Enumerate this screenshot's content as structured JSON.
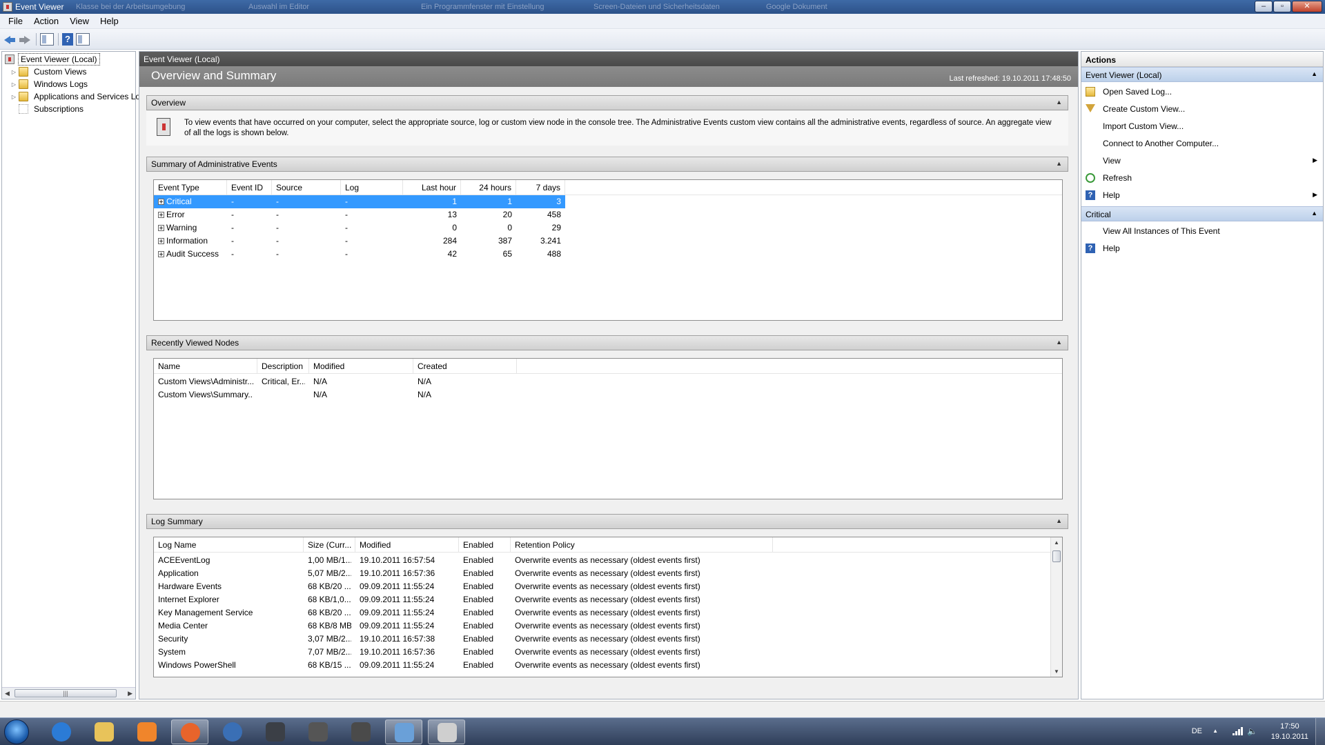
{
  "window": {
    "title": "Event Viewer",
    "ghost_tabs": [
      "Klasse bei der Arbeitsumgebung",
      "Auswahl im Editor",
      "Ein Programmfenster mit Einstellung",
      "Screen-Dateien und Sicherheitsdaten",
      "Google Dokument"
    ]
  },
  "menu": [
    "File",
    "Action",
    "View",
    "Help"
  ],
  "tree": [
    {
      "label": "Event Viewer (Local)",
      "icon": "event-viewer-icon"
    },
    {
      "label": "Custom Views",
      "icon": "folder-icon"
    },
    {
      "label": "Windows Logs",
      "icon": "folder-icon"
    },
    {
      "label": "Applications and Services Lo",
      "icon": "folder-icon"
    },
    {
      "label": "Subscriptions",
      "icon": "subscriptions-icon"
    }
  ],
  "center": {
    "header": "Event Viewer (Local)",
    "banner_title": "Overview and Summary",
    "last_refreshed": "Last refreshed: 19.10.2011 17:48:50",
    "overview": {
      "title": "Overview",
      "text": "To view events that have occurred on your computer, select the appropriate source, log or custom view node in the console tree. The Administrative Events custom view contains all the administrative events, regardless of source. An aggregate view of all the logs is shown below."
    },
    "summary": {
      "title": "Summary of Administrative Events",
      "columns": [
        "Event Type",
        "Event ID",
        "Source",
        "Log",
        "Last hour",
        "24 hours",
        "7 days"
      ],
      "rows": [
        [
          "Critical",
          "-",
          "-",
          "-",
          "1",
          "1",
          "3"
        ],
        [
          "Error",
          "-",
          "-",
          "-",
          "13",
          "20",
          "458"
        ],
        [
          "Warning",
          "-",
          "-",
          "-",
          "0",
          "0",
          "29"
        ],
        [
          "Information",
          "-",
          "-",
          "-",
          "284",
          "387",
          "3.241"
        ],
        [
          "Audit Success",
          "-",
          "-",
          "-",
          "42",
          "65",
          "488"
        ]
      ]
    },
    "recent": {
      "title": "Recently Viewed Nodes",
      "columns": [
        "Name",
        "Description",
        "Modified",
        "Created"
      ],
      "rows": [
        [
          "Custom Views\\Administr...",
          "Critical, Er...",
          "N/A",
          "N/A"
        ],
        [
          "Custom Views\\Summary...",
          "",
          "N/A",
          "N/A"
        ]
      ]
    },
    "log_summary": {
      "title": "Log Summary",
      "columns": [
        "Log Name",
        "Size (Curr...",
        "Modified",
        "Enabled",
        "Retention Policy"
      ],
      "rows": [
        [
          "ACEEventLog",
          "1,00 MB/1...",
          "19.10.2011 16:57:54",
          "Enabled",
          "Overwrite events as necessary (oldest events first)"
        ],
        [
          "Application",
          "5,07 MB/2...",
          "19.10.2011 16:57:36",
          "Enabled",
          "Overwrite events as necessary (oldest events first)"
        ],
        [
          "Hardware Events",
          "68 KB/20 ...",
          "09.09.2011 11:55:24",
          "Enabled",
          "Overwrite events as necessary (oldest events first)"
        ],
        [
          "Internet Explorer",
          "68 KB/1,0...",
          "09.09.2011 11:55:24",
          "Enabled",
          "Overwrite events as necessary (oldest events first)"
        ],
        [
          "Key Management Service",
          "68 KB/20 ...",
          "09.09.2011 11:55:24",
          "Enabled",
          "Overwrite events as necessary (oldest events first)"
        ],
        [
          "Media Center",
          "68 KB/8 MB",
          "09.09.2011 11:55:24",
          "Enabled",
          "Overwrite events as necessary (oldest events first)"
        ],
        [
          "Security",
          "3,07 MB/2...",
          "19.10.2011 16:57:38",
          "Enabled",
          "Overwrite events as necessary (oldest events first)"
        ],
        [
          "System",
          "7,07 MB/2...",
          "19.10.2011 16:57:36",
          "Enabled",
          "Overwrite events as necessary (oldest events first)"
        ],
        [
          "Windows PowerShell",
          "68 KB/15 ...",
          "09.09.2011 11:55:24",
          "Enabled",
          "Overwrite events as necessary (oldest events first)"
        ]
      ]
    }
  },
  "actions": {
    "title": "Actions",
    "group1": {
      "title": "Event Viewer (Local)",
      "items": [
        {
          "label": "Open Saved Log...",
          "icon": "open-log-icon"
        },
        {
          "label": "Create Custom View...",
          "icon": "filter-icon"
        },
        {
          "label": "Import Custom View...",
          "icon": ""
        },
        {
          "label": "Connect to Another Computer...",
          "icon": ""
        },
        {
          "label": "View",
          "icon": "",
          "submenu": true
        },
        {
          "label": "Refresh",
          "icon": "refresh-icon"
        },
        {
          "label": "Help",
          "icon": "help-icon",
          "submenu": true
        }
      ]
    },
    "group2": {
      "title": "Critical",
      "items": [
        {
          "label": "View All Instances of This Event",
          "icon": ""
        },
        {
          "label": "Help",
          "icon": "help-icon"
        }
      ]
    }
  },
  "taskbar": {
    "apps": [
      {
        "name": "internet-explorer",
        "color": "#2b7bd6"
      },
      {
        "name": "file-explorer",
        "color": "#e8c35a"
      },
      {
        "name": "media-player",
        "color": "#f0852b"
      },
      {
        "name": "firefox",
        "color": "#e8642b",
        "active": true
      },
      {
        "name": "thunderbird",
        "color": "#3a6fb5"
      },
      {
        "name": "steam",
        "color": "#3b3f46"
      },
      {
        "name": "ch-app",
        "color": "#555555"
      },
      {
        "name": "headset-app",
        "color": "#4a4a4a"
      },
      {
        "name": "control-panel",
        "color": "#6aa0d8",
        "active": true
      },
      {
        "name": "event-viewer",
        "color": "#cfcfcf",
        "active": true
      }
    ],
    "lang": "DE",
    "time": "17:50",
    "date": "19.10.2011"
  },
  "colors": {
    "selection": "#3399ff",
    "titlebar": "#2c5189",
    "center_header": "#4a4a4a",
    "action_group": "#bcd0ea"
  }
}
